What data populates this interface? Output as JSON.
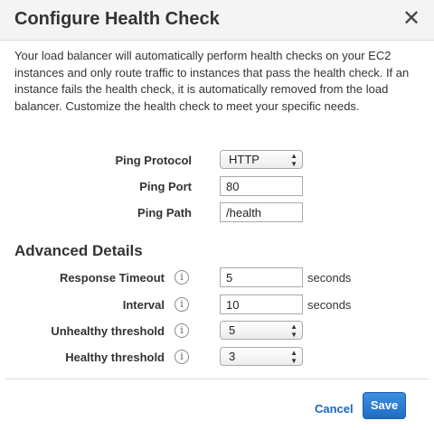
{
  "dialog": {
    "title": "Configure Health Check",
    "close_icon": "close-icon",
    "description": "Your load balancer will automatically perform health checks on your EC2 instances and only route traffic to instances that pass the health check. If an instance fails the health check, it is automatically removed from the load balancer. Customize the health check to meet your specific needs."
  },
  "basic": {
    "ping_protocol": {
      "label": "Ping Protocol",
      "value": "HTTP"
    },
    "ping_port": {
      "label": "Ping Port",
      "value": "80"
    },
    "ping_path": {
      "label": "Ping Path",
      "value": "/health"
    }
  },
  "advanced": {
    "title": "Advanced Details",
    "response_timeout": {
      "label": "Response Timeout",
      "value": "5",
      "unit": "seconds",
      "info_icon": "info-icon"
    },
    "interval": {
      "label": "Interval",
      "value": "10",
      "unit": "seconds",
      "info_icon": "info-icon"
    },
    "unhealthy_threshold": {
      "label": "Unhealthy threshold",
      "value": "5",
      "info_icon": "info-icon"
    },
    "healthy_threshold": {
      "label": "Healthy threshold",
      "value": "3",
      "info_icon": "info-icon"
    }
  },
  "footer": {
    "cancel_label": "Cancel",
    "save_label": "Save"
  },
  "colors": {
    "link": "#1a66c2",
    "primary_button": "#2a7bd5",
    "header_bg": "#f4f4f4"
  }
}
